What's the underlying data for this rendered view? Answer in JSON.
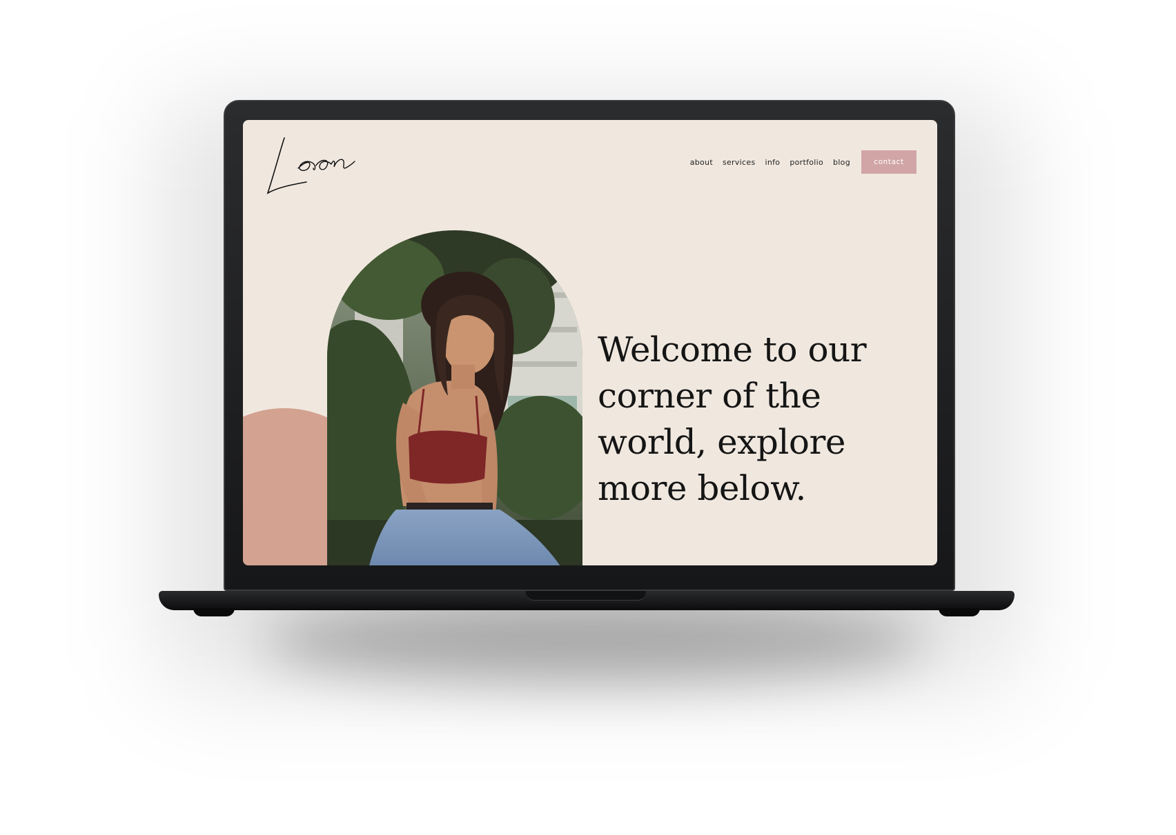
{
  "site": {
    "logo_text": "Leon",
    "nav": {
      "items": [
        {
          "label": "about"
        },
        {
          "label": "services"
        },
        {
          "label": "info"
        },
        {
          "label": "portfolio"
        },
        {
          "label": "blog"
        }
      ],
      "contact_label": "contact"
    },
    "hero": {
      "headline_lines": [
        "Welcome to our",
        "corner of the",
        "world, explore",
        "more below."
      ]
    }
  },
  "colors": {
    "page_background": "#f0e8df",
    "accent_pink": "#d1a5a6",
    "circle_terracotta": "#d4a291",
    "text_dark": "#151515",
    "laptop_body": "#1c1d1f"
  },
  "icons": [
    "logo-script-icon"
  ]
}
